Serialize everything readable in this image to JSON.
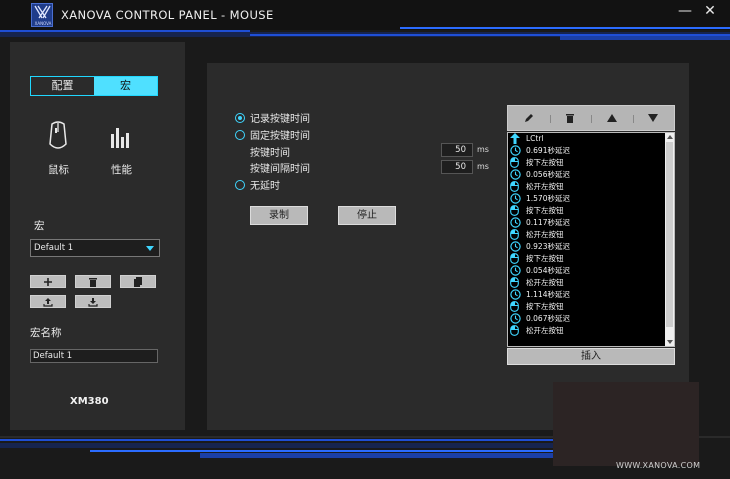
{
  "window": {
    "title": "XANOVA CONTROL PANEL - MOUSE",
    "logo_text": "XANOVA",
    "minimize": "—",
    "close": "✕"
  },
  "left": {
    "tabs": [
      {
        "label": "配置",
        "active": false
      },
      {
        "label": "宏",
        "active": true
      }
    ],
    "mouse_label": "鼠标",
    "perf_label": "性能",
    "macro_label": "宏",
    "macro_select": "Default 1",
    "macro_name_label": "宏名称",
    "macro_name_value": "Default 1",
    "model": "XM380"
  },
  "record": {
    "options": [
      {
        "label": "记录按键时间",
        "selected": true
      },
      {
        "label": "固定按键时间",
        "selected": false
      },
      {
        "label": "无延时",
        "selected": false
      }
    ],
    "key_time_label": "按键时间",
    "key_time_value": "50",
    "key_interval_label": "按键间隔时间",
    "key_interval_value": "50",
    "unit": "ms",
    "record_button": "录制",
    "stop_button": "停止"
  },
  "macro_list": {
    "items": [
      {
        "icon": "arrow-up-icon",
        "text": "LCtrl"
      },
      {
        "icon": "clock-icon",
        "text": "0.691秒延迟"
      },
      {
        "icon": "mouse-icon",
        "text": "按下左按钮"
      },
      {
        "icon": "clock-icon",
        "text": "0.056秒延迟"
      },
      {
        "icon": "mouse-icon",
        "text": "松开左按钮"
      },
      {
        "icon": "clock-icon",
        "text": "1.570秒延迟"
      },
      {
        "icon": "mouse-icon",
        "text": "按下左按钮"
      },
      {
        "icon": "clock-icon",
        "text": "0.117秒延迟"
      },
      {
        "icon": "mouse-icon",
        "text": "松开左按钮"
      },
      {
        "icon": "clock-icon",
        "text": "0.923秒延迟"
      },
      {
        "icon": "mouse-icon",
        "text": "按下左按钮"
      },
      {
        "icon": "clock-icon",
        "text": "0.054秒延迟"
      },
      {
        "icon": "mouse-icon",
        "text": "松开左按钮"
      },
      {
        "icon": "clock-icon",
        "text": "1.114秒延迟"
      },
      {
        "icon": "mouse-icon",
        "text": "按下左按钮"
      },
      {
        "icon": "clock-icon",
        "text": "0.067秒延迟"
      },
      {
        "icon": "mouse-icon",
        "text": "松开左按钮"
      }
    ],
    "insert_button": "插入"
  },
  "footer": {
    "website": "WWW.XANOVA.COM"
  },
  "colors": {
    "accent": "#3fd6ff",
    "stripe_blue": "#1f4fd6",
    "panel": "#2b2b2b"
  }
}
